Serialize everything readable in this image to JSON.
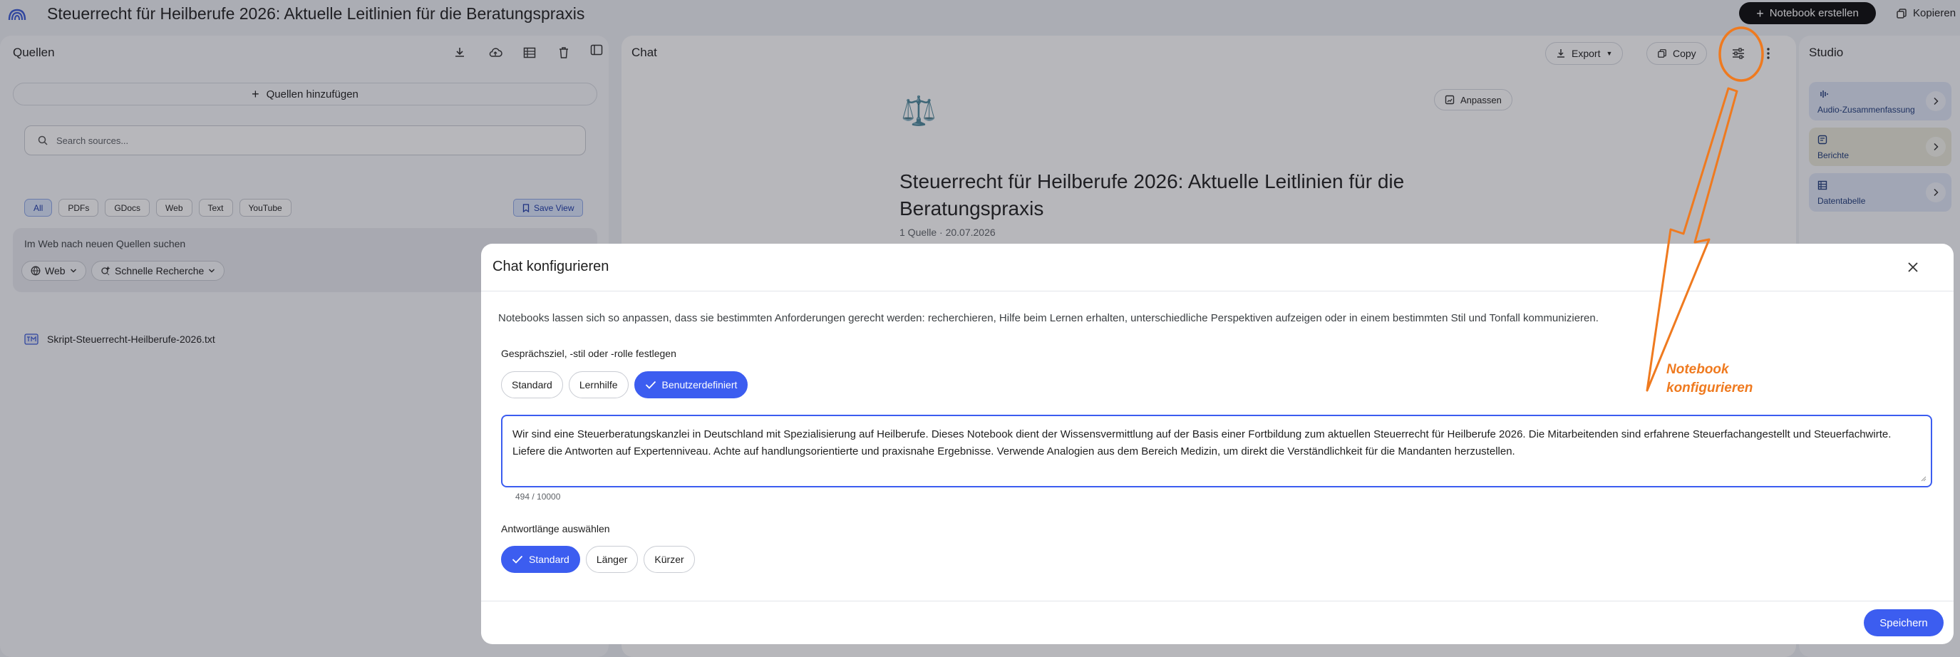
{
  "app": {
    "title": "Steuerrecht für Heilberufe 2026: Aktuelle Leitlinien für die Beratungspraxis",
    "create_notebook": "Notebook erstellen",
    "copy_top": "Kopieren"
  },
  "sources": {
    "heading": "Quellen",
    "add_sources": "Quellen hinzufügen",
    "search_placeholder": "Search sources...",
    "filters": [
      "All",
      "PDFs",
      "GDocs",
      "Web",
      "Text",
      "YouTube"
    ],
    "save_view": "Save View",
    "web_search_label": "Im Web nach neuen Quellen suchen",
    "web_dropdown": "Web",
    "research_dropdown": "Schnelle Recherche",
    "items": [
      {
        "name": "Skript-Steuerrecht-Heilberufe-2026.txt"
      }
    ]
  },
  "chat": {
    "heading": "Chat",
    "export": "Export",
    "copy": "Copy",
    "anpassen": "Anpassen",
    "notebook_emoji": "⚖️",
    "notebook_title": "Steuerrecht für Heilberufe 2026: Aktuelle Leitlinien für die Beratungspraxis",
    "meta": "1 Quelle · 20.07.2026"
  },
  "studio": {
    "heading": "Studio",
    "cards": [
      {
        "label": "Audio-Zusammenfassung",
        "color": "#dfe6f7"
      },
      {
        "label": "Berichte",
        "color": "#e9e8d9"
      },
      {
        "label": "Datentabelle",
        "color": "#dfe6f7"
      }
    ]
  },
  "modal": {
    "title": "Chat konfigurieren",
    "description": "Notebooks lassen sich so anpassen, dass sie bestimmten Anforderungen gerecht werden: recherchieren, Hilfe beim Lernen erhalten, unterschiedliche Perspektiven aufzeigen oder in einem bestimmten Stil und Tonfall kommunizieren.",
    "goal_label": "Gesprächsziel, -stil oder -rolle festlegen",
    "goal_options": [
      "Standard",
      "Lernhilfe",
      "Benutzerdefiniert"
    ],
    "goal_selected": "Benutzerdefiniert",
    "prompt_text": "Wir sind eine Steuerberatungskanzlei in Deutschland mit Spezialisierung auf Heilberufe. Dieses Notebook dient der Wissensvermittlung auf der Basis einer Fortbildung zum aktuellen Steuerrecht für Heilberufe 2026. Die Mitarbeitenden sind erfahrene Steuerfachangestellt und Steuerfachwirte. Liefere die Antworten auf Expertenniveau. Achte auf handlungsorientierte und praxisnahe Ergebnisse. Verwende Analogien aus dem Bereich Medizin, um direkt die Verständlichkeit für die Mandanten herzustellen.",
    "char_count": "494 / 10000",
    "length_label": "Antwortlänge auswählen",
    "length_options": [
      "Standard",
      "Länger",
      "Kürzer"
    ],
    "length_selected": "Standard",
    "save": "Speichern"
  },
  "annotation": {
    "line1": "Notebook",
    "line2": "konfigurieren",
    "color": "#ef7a1f"
  },
  "colors": {
    "accent": "#3c5df0",
    "panel_bg": "#f8f9fc",
    "page_bg": "#eef0f5"
  }
}
